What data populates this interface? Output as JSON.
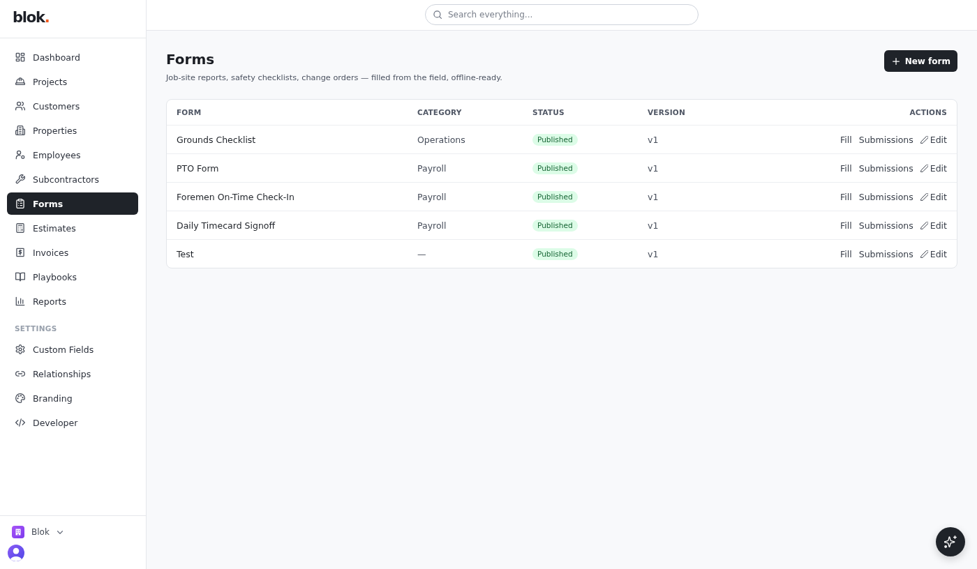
{
  "sidebar": {
    "logo": {
      "name": "blok",
      "mark": "."
    },
    "nav_items": [
      {
        "label": "Dashboard",
        "selected": false
      },
      {
        "label": "Projects",
        "selected": false
      },
      {
        "label": "Customers",
        "selected": false
      },
      {
        "label": "Properties",
        "selected": false
      },
      {
        "label": "Employees",
        "selected": false
      },
      {
        "label": "Subcontractors",
        "selected": false
      },
      {
        "label": "Forms",
        "selected": true
      },
      {
        "label": "Estimates",
        "selected": false
      },
      {
        "label": "Invoices",
        "selected": false
      },
      {
        "label": "Playbooks",
        "selected": false
      },
      {
        "label": "Reports",
        "selected": false
      }
    ],
    "settings": {
      "heading": "SETTINGS",
      "items": [
        {
          "label": "Custom Fields",
          "selected": false
        },
        {
          "label": "Relationships",
          "selected": false
        },
        {
          "label": "Branding",
          "selected": false
        },
        {
          "label": "Developer",
          "selected": false
        }
      ]
    },
    "workspace": {
      "name": "Blok"
    }
  },
  "top_bar": {
    "search": {
      "placeholder": "Search everything..."
    }
  },
  "page": {
    "title": "Forms",
    "subtitle": "Job-site reports, safety checklists, change orders — filled from the field, offline-ready.",
    "primary_button": "New form"
  },
  "table": {
    "columns": [
      "FORM",
      "CATEGORY",
      "STATUS",
      "VERSION",
      "ACTIONS"
    ],
    "rows": [
      {
        "form": "Grounds Checklist",
        "category": "Operations",
        "status": "Published",
        "version": "v1",
        "actions": [
          {
            "label": "Fill",
            "kind": "link"
          },
          {
            "label": "Submissions",
            "kind": "link"
          },
          {
            "label": "Edit",
            "kind": "edit"
          }
        ]
      },
      {
        "form": "PTO Form",
        "category": "Payroll",
        "status": "Published",
        "version": "v1",
        "actions": [
          {
            "label": "Fill",
            "kind": "link"
          },
          {
            "label": "Submissions",
            "kind": "link"
          },
          {
            "label": "Edit",
            "kind": "edit"
          }
        ]
      },
      {
        "form": "Foremen On-Time Check-In",
        "category": "Payroll",
        "status": "Published",
        "version": "v1",
        "actions": [
          {
            "label": "Fill",
            "kind": "link"
          },
          {
            "label": "Submissions",
            "kind": "link"
          },
          {
            "label": "Edit",
            "kind": "edit"
          }
        ]
      },
      {
        "form": "Daily Timecard Signoff",
        "category": "Payroll",
        "status": "Published",
        "version": "v1",
        "actions": [
          {
            "label": "Fill",
            "kind": "link"
          },
          {
            "label": "Submissions",
            "kind": "link"
          },
          {
            "label": "Edit",
            "kind": "edit"
          }
        ]
      },
      {
        "form": "Test",
        "category": "—",
        "status": "Published",
        "version": "v1",
        "actions": [
          {
            "label": "Fill",
            "kind": "link"
          },
          {
            "label": "Submissions",
            "kind": "link"
          },
          {
            "label": "Edit",
            "kind": "edit"
          }
        ]
      }
    ]
  }
}
